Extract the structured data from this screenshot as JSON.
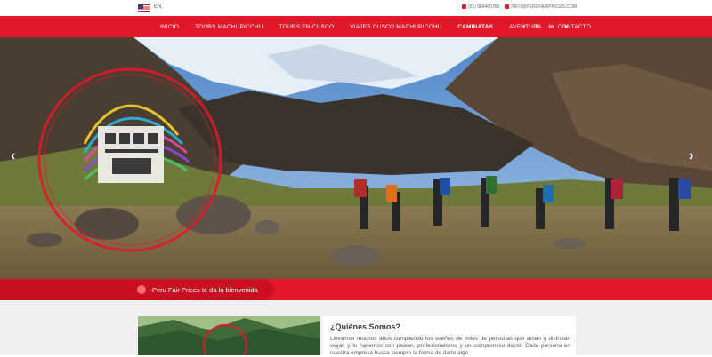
{
  "topbar": {
    "language": "EN",
    "phone": "(51) 984466750",
    "email": "INFO@PERUFAIRPRICES.COM"
  },
  "nav": {
    "items": [
      {
        "label": "INICIO"
      },
      {
        "label": "TOURS MACHUPICCHU"
      },
      {
        "label": "TOURS EN CUSCO"
      },
      {
        "label": "VIAJES CUSCO MACHUPICCHU"
      },
      {
        "label": "CAMINATAS"
      },
      {
        "label": "AVENTURA"
      },
      {
        "label": "CONTACTO"
      }
    ],
    "active": "CAMINATAS",
    "social": [
      {
        "icon": "twitter-icon",
        "glyph": "t"
      },
      {
        "icon": "facebook-icon",
        "glyph": "f"
      },
      {
        "icon": "linkedin-icon",
        "glyph": "in"
      },
      {
        "icon": "vimeo-icon",
        "glyph": "v"
      }
    ]
  },
  "hero": {
    "prev_glyph": "‹",
    "next_glyph": "›"
  },
  "welcome": {
    "text": "Peru Fair Prices te da la bienvenida"
  },
  "about": {
    "title": "¿Quiénes Somos?",
    "text": "Llevamos muchos años cumpliendo los sueños de miles de personas que aman y disfrutan viajar, y lo hacemos con pasión, profesionalismo y un compromiso diario. Cada persona en nuestra empresa busca siempre la forma de darte algo"
  },
  "colors": {
    "brand_red": "#e3172a",
    "brand_dark_red": "#c90f20"
  }
}
